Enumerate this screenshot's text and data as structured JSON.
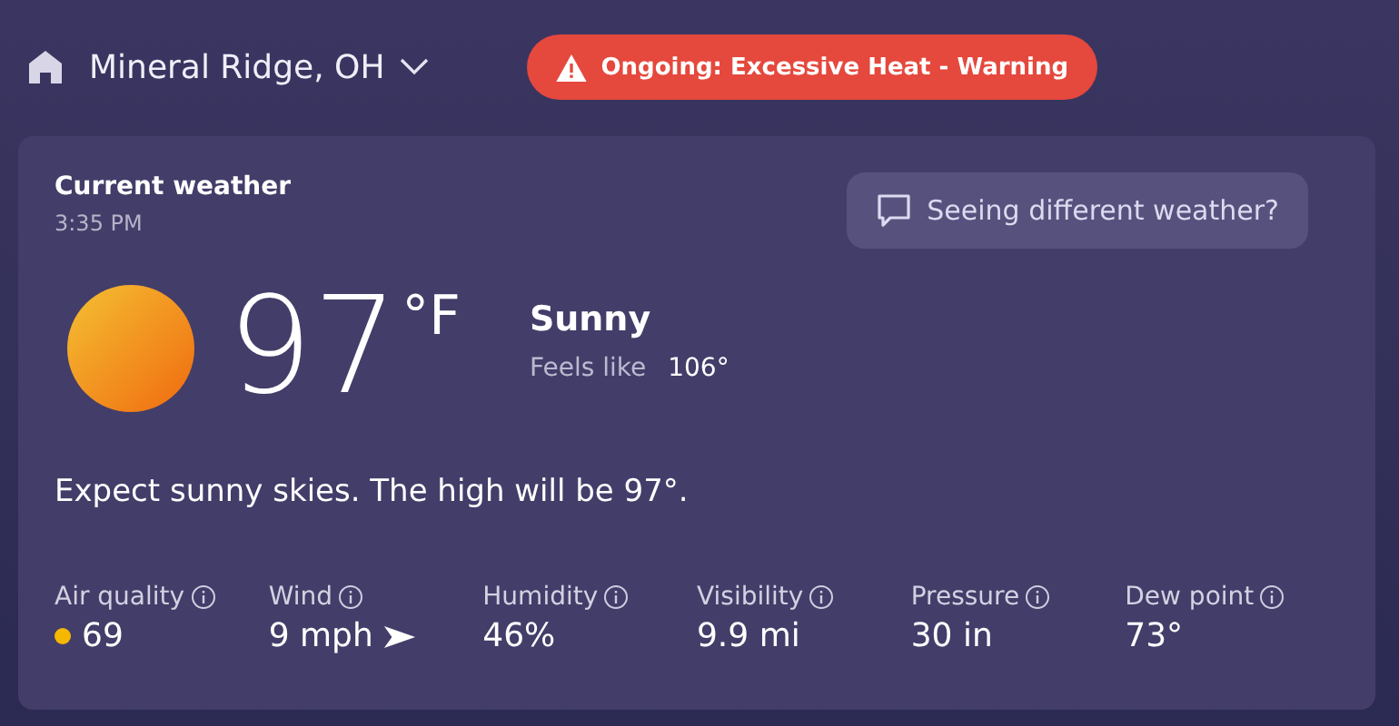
{
  "header": {
    "location": "Mineral Ridge, OH",
    "alert": "Ongoing: Excessive Heat - Warning"
  },
  "current": {
    "title": "Current weather",
    "time": "3:35 PM",
    "feedback_button": "Seeing different weather?",
    "temperature": "97",
    "unit": "°F",
    "condition": "Sunny",
    "feels_like_label": "Feels like",
    "feels_like": "106°",
    "summary": "Expect sunny skies. The high will be 97°."
  },
  "stats": [
    {
      "kind": "dot",
      "label": "Air quality",
      "value": "69",
      "color": "#f5b800"
    },
    {
      "kind": "wind",
      "label": "Wind",
      "value": "9 mph"
    },
    {
      "kind": "plain",
      "label": "Humidity",
      "value": "46%"
    },
    {
      "kind": "plain",
      "label": "Visibility",
      "value": "9.9 mi"
    },
    {
      "kind": "plain",
      "label": "Pressure",
      "value": "30 in"
    },
    {
      "kind": "plain",
      "label": "Dew point",
      "value": "73°"
    }
  ]
}
